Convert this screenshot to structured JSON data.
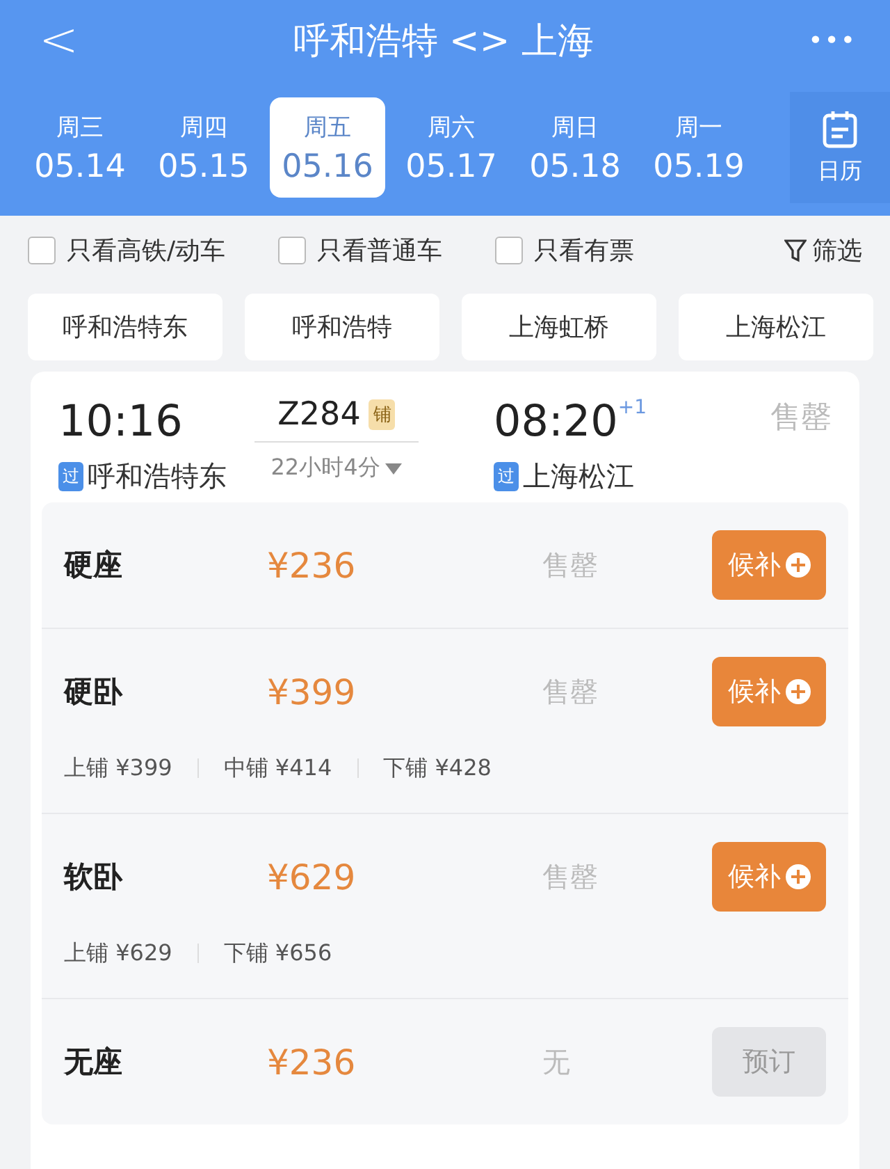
{
  "header": {
    "back": "<",
    "title": "呼和浩特 <> 上海",
    "more": "•••"
  },
  "dates": [
    {
      "weekday": "周三",
      "date": "05.14",
      "selected": false
    },
    {
      "weekday": "周四",
      "date": "05.15",
      "selected": false
    },
    {
      "weekday": "周五",
      "date": "05.16",
      "selected": true
    },
    {
      "weekday": "周六",
      "date": "05.17",
      "selected": false
    },
    {
      "weekday": "周日",
      "date": "05.18",
      "selected": false
    },
    {
      "weekday": "周一",
      "date": "05.19",
      "selected": false
    }
  ],
  "calendar": {
    "label": "日历"
  },
  "filters": [
    {
      "label": "只看高铁/动车",
      "checked": false
    },
    {
      "label": "只看普通车",
      "checked": false
    },
    {
      "label": "只看有票",
      "checked": false
    }
  ],
  "filter_button": "筛选",
  "stations": [
    "呼和浩特东",
    "呼和浩特",
    "上海虹桥",
    "上海松江"
  ],
  "train": {
    "depart_time": "10:16",
    "depart_badge": "过",
    "depart_station": "呼和浩特东",
    "number": "Z284",
    "tag": "铺",
    "duration": "22小时4分",
    "arrive_time": "08:20",
    "day_offset": "+1",
    "arrive_badge": "过",
    "arrive_station": "上海松江",
    "status": "售罄"
  },
  "seats": [
    {
      "name": "硬座",
      "price": "¥236",
      "status": "售罄",
      "button": {
        "kind": "waitlist",
        "label": "候补"
      }
    },
    {
      "name": "硬卧",
      "price": "¥399",
      "status": "售罄",
      "button": {
        "kind": "waitlist",
        "label": "候补"
      },
      "berths": [
        "上铺 ¥399",
        "中铺 ¥414",
        "下铺 ¥428"
      ]
    },
    {
      "name": "软卧",
      "price": "¥629",
      "status": "售罄",
      "button": {
        "kind": "waitlist",
        "label": "候补"
      },
      "berths": [
        "上铺 ¥629",
        "下铺 ¥656"
      ]
    },
    {
      "name": "无座",
      "price": "¥236",
      "status": "无",
      "button": {
        "kind": "book",
        "label": "预订",
        "disabled": true
      }
    }
  ]
}
